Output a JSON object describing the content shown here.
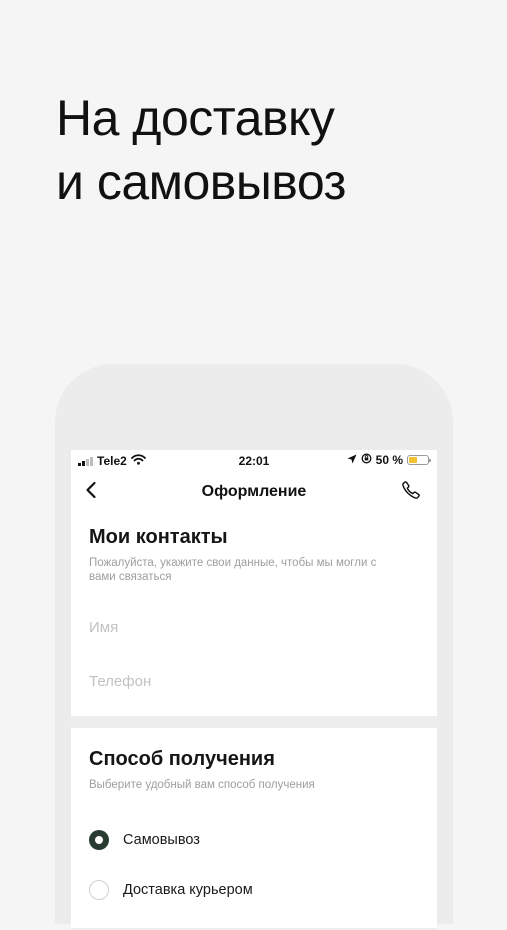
{
  "headline": {
    "line1": "На доставку",
    "line2": "и самовывоз"
  },
  "status_bar": {
    "carrier": "Tele2",
    "time": "22:01",
    "battery_text": "50 %",
    "battery_level": 0.5,
    "icons": [
      "signal-icon",
      "wifi-icon",
      "location-arrow-icon",
      "rotation-lock-icon",
      "battery-icon"
    ]
  },
  "nav": {
    "title": "Оформление",
    "back_icon": "chevron-left-icon",
    "phone_icon": "phone-icon"
  },
  "contacts": {
    "title": "Мои контакты",
    "hint": "Пожалуйста, укажите свои данные, чтобы мы могли с вами связаться",
    "name_placeholder": "Имя",
    "phone_placeholder": "Телефон"
  },
  "delivery": {
    "title": "Способ получения",
    "hint": "Выберите удобный вам способ получения",
    "options": [
      {
        "label": "Самовывоз",
        "selected": true
      },
      {
        "label": "Доставка курьером",
        "selected": false
      }
    ]
  },
  "colors": {
    "page_background": "#f5f5f5",
    "radio_selected": "#2a3b32",
    "battery": "#f2c230",
    "hint_text": "#9e9e9e"
  }
}
